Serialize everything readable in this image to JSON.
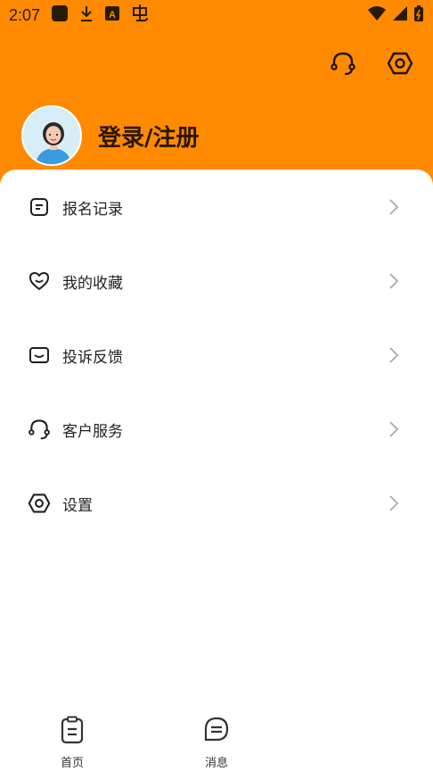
{
  "status_bar": {
    "time": "2:07",
    "left_icons": [
      "app-square-icon",
      "download-icon",
      "text-a-icon",
      "chinese-char-icon"
    ],
    "right_icons": [
      "wifi-icon",
      "signal-icon",
      "battery-icon"
    ]
  },
  "header": {
    "background": "#ff8a00",
    "actions": [
      "headset-icon",
      "settings-hex-icon"
    ]
  },
  "profile": {
    "login_label": "登录/注册"
  },
  "menu": {
    "items": [
      {
        "label": "报名记录",
        "icon": "registration-record-icon"
      },
      {
        "label": "我的收藏",
        "icon": "heart-icon"
      },
      {
        "label": "投诉反馈",
        "icon": "feedback-icon"
      },
      {
        "label": "客户服务",
        "icon": "headset-icon"
      },
      {
        "label": "设置",
        "icon": "settings-hex-icon"
      }
    ]
  },
  "tabbar": {
    "tabs": [
      {
        "label": "首页",
        "icon": "clipboard-icon"
      },
      {
        "label": "消息",
        "icon": "message-icon"
      }
    ]
  }
}
